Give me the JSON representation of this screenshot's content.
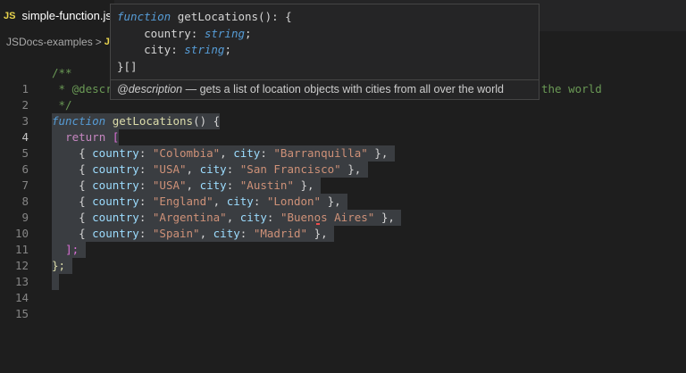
{
  "tab": {
    "badge": "JS",
    "filename": "simple-function.js"
  },
  "breadcrumb": {
    "folder": "JSDocs-examples",
    "separator": ">",
    "file_badge": "J"
  },
  "hover": {
    "sig_line1_kw": "function",
    "sig_line1_name": "getLocations(): {",
    "sig_country": "country",
    "sig_colon1": ": ",
    "sig_type1": "string",
    "sig_semi1": ";",
    "sig_city": "city",
    "sig_colon2": ": ",
    "sig_type2": "string",
    "sig_semi2": ";",
    "sig_close": "}[]",
    "desc_tag": "@description",
    "desc_text": " — gets a list of location objects with cities from all over the world"
  },
  "editor": {
    "line_numbers": [
      "1",
      "2",
      "3",
      "4",
      "5",
      "6",
      "7",
      "8",
      "9",
      "10",
      "11",
      "12",
      "13",
      "14",
      "15"
    ],
    "line1": "/**",
    "line2_start": " * @descr",
    "line2_end": "the world",
    "line3": " */",
    "line4_kw": "function",
    "line4_fn": "getLocations",
    "line4_rest": "() {",
    "line5_kw": "return",
    "line5_rest": " [",
    "rows": [
      {
        "country": "\"Colombia\"",
        "city": "\"Barranquilla\""
      },
      {
        "country": "\"USA\"",
        "city": "\"San Francisco\""
      },
      {
        "country": "\"USA\"",
        "city": "\"Austin\""
      },
      {
        "country": "\"England\"",
        "city": "\"London\""
      },
      {
        "country": "\"Argentina\"",
        "city": "\"Buenos Aires\""
      },
      {
        "country": "\"Spain\"",
        "city": "\"Madrid\""
      }
    ],
    "key_country": "country",
    "key_city": "city",
    "line12": "];",
    "line13": "};"
  }
}
